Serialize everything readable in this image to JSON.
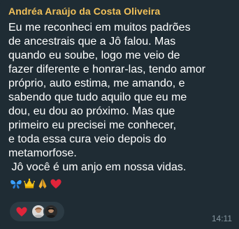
{
  "message": {
    "sender_name": "Andréa Araújo da Costa Oliveira",
    "lines": [
      "Eu me reconheci em muitos padrões",
      "de ancestrais que a Jô falou. Mas",
      "quando eu soube, logo me veio de",
      "fazer diferente e honrar-las, tendo amor",
      "próprio, auto estima, me amando, e",
      "sabendo que tudo aquilo que eu me",
      "dou, eu dou ao próximo. Mas que",
      "primeiro eu precisei me conhecer,",
      "e toda essa cura veio depois do",
      "metamorfose.",
      " Jô você é um anjo em nossa vidas."
    ],
    "emojis": [
      "butterfly-icon",
      "crown-icon",
      "praying-hands-icon",
      "red-heart-icon"
    ],
    "time": "14:11"
  },
  "reactions": {
    "items": [
      "red-heart-icon",
      "reactor-avatar-1",
      "reactor-avatar-2"
    ]
  },
  "colors": {
    "background": "#1f2c34",
    "sender": "#f2c15a",
    "text": "#ffffff",
    "meta": "#8696a0",
    "reaction_pill": "#2c3b44"
  }
}
